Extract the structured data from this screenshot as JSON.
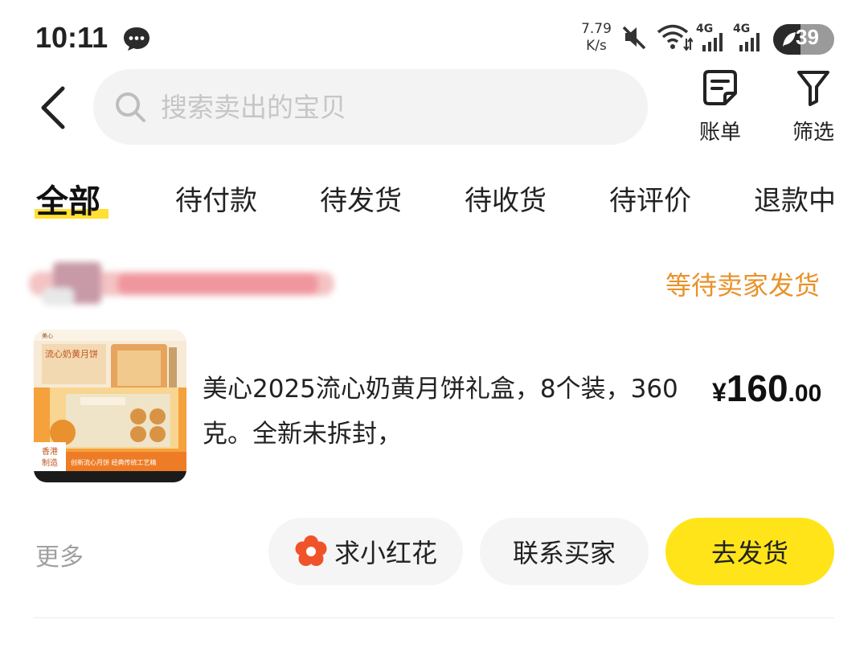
{
  "status_bar": {
    "time": "10:11",
    "speed_value": "7.79",
    "speed_unit": "K/s",
    "net1": "4G",
    "net2": "4G",
    "battery": "39",
    "icons": [
      "message-bubble-icon",
      "mute-icon",
      "wifi-icon",
      "signal-icon",
      "signal-icon",
      "battery-saver-icon"
    ]
  },
  "header": {
    "search_placeholder": "搜索卖出的宝贝",
    "bill_label": "账单",
    "filter_label": "筛选"
  },
  "tabs": [
    {
      "label": "全部",
      "active": true
    },
    {
      "label": "待付款",
      "active": false
    },
    {
      "label": "待发货",
      "active": false
    },
    {
      "label": "待收货",
      "active": false
    },
    {
      "label": "待评价",
      "active": false
    },
    {
      "label": "退款中",
      "active": false
    }
  ],
  "order": {
    "status": "等待卖家发货",
    "product": {
      "title": "美心2025流心奶黄月饼礼盒，8个装，360克。全新未拆封，",
      "image_text": {
        "box_title": "流心奶黄月饼",
        "brand_top": "美心",
        "badge_line1": "香港",
        "badge_line2": "制造",
        "bottom_banner": "创新流心月饼 经典传统工艺精"
      }
    },
    "price": {
      "currency": "¥",
      "integer": "160",
      "decimal": ".00"
    },
    "actions": {
      "more": "更多",
      "flower": "求小红花",
      "contact": "联系买家",
      "ship": "去发货"
    }
  },
  "colors": {
    "accent_yellow": "#ffe41a",
    "status_orange": "#e8922a",
    "flower_red": "#f0532a"
  }
}
